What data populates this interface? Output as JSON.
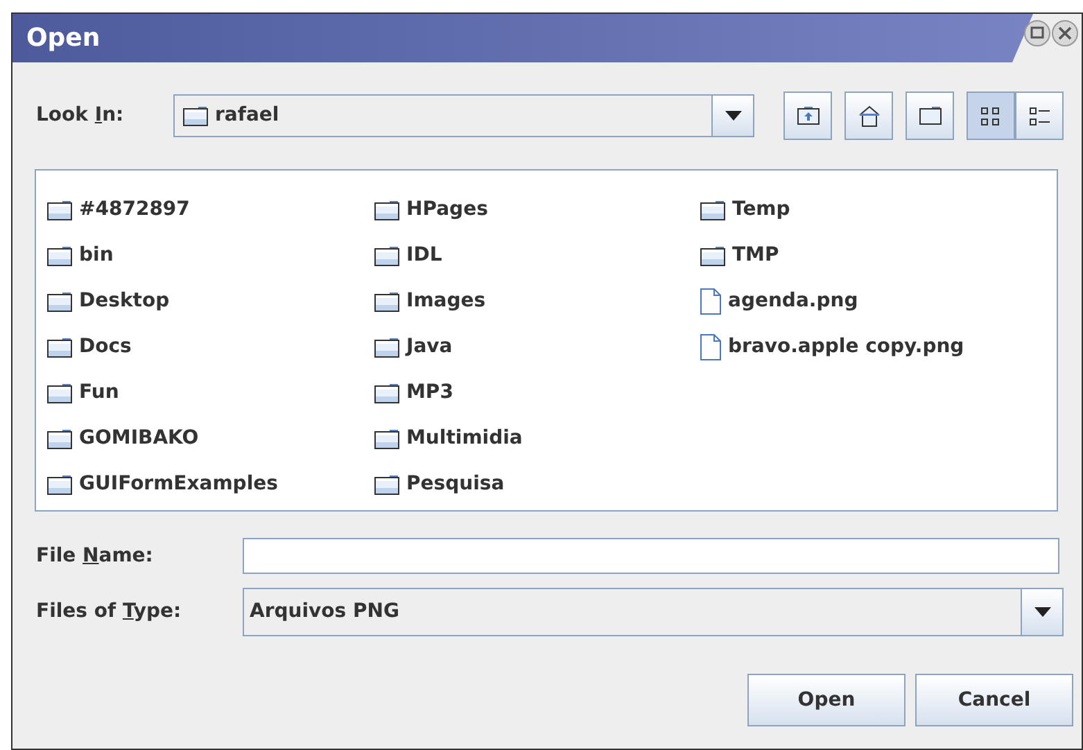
{
  "window": {
    "title": "Open"
  },
  "look_in": {
    "label": {
      "before": "Look ",
      "key": "I",
      "after": "n:"
    },
    "value": "rafael"
  },
  "toolbar": [
    {
      "kind": "up"
    },
    {
      "kind": "home"
    },
    {
      "kind": "new-folder"
    },
    {
      "kind": "list",
      "selected": true
    },
    {
      "kind": "details",
      "selected": false
    }
  ],
  "files": [
    {
      "name": "#4872897",
      "kind": "folder"
    },
    {
      "name": "bin",
      "kind": "folder"
    },
    {
      "name": "Desktop",
      "kind": "folder"
    },
    {
      "name": "Docs",
      "kind": "folder"
    },
    {
      "name": "Fun",
      "kind": "folder"
    },
    {
      "name": "GOMIBAKO",
      "kind": "folder"
    },
    {
      "name": "GUIFormExamples",
      "kind": "folder"
    },
    {
      "name": "HPages",
      "kind": "folder"
    },
    {
      "name": "IDL",
      "kind": "folder"
    },
    {
      "name": "Images",
      "kind": "folder"
    },
    {
      "name": "Java",
      "kind": "folder"
    },
    {
      "name": "MP3",
      "kind": "folder"
    },
    {
      "name": "Multimidia",
      "kind": "folder"
    },
    {
      "name": "Pesquisa",
      "kind": "folder"
    },
    {
      "name": "Temp",
      "kind": "folder"
    },
    {
      "name": "TMP",
      "kind": "folder"
    },
    {
      "name": "agenda.png",
      "kind": "file"
    },
    {
      "name": "bravo.apple copy.png",
      "kind": "file"
    }
  ],
  "file_name": {
    "label": {
      "before": "File ",
      "key": "N",
      "after": "ame:"
    }
  },
  "file_type": {
    "label": {
      "before": "Files of ",
      "key": "T",
      "after": "ype:"
    },
    "value": "Arquivos PNG"
  },
  "buttons": [
    "Open",
    "Cancel"
  ]
}
